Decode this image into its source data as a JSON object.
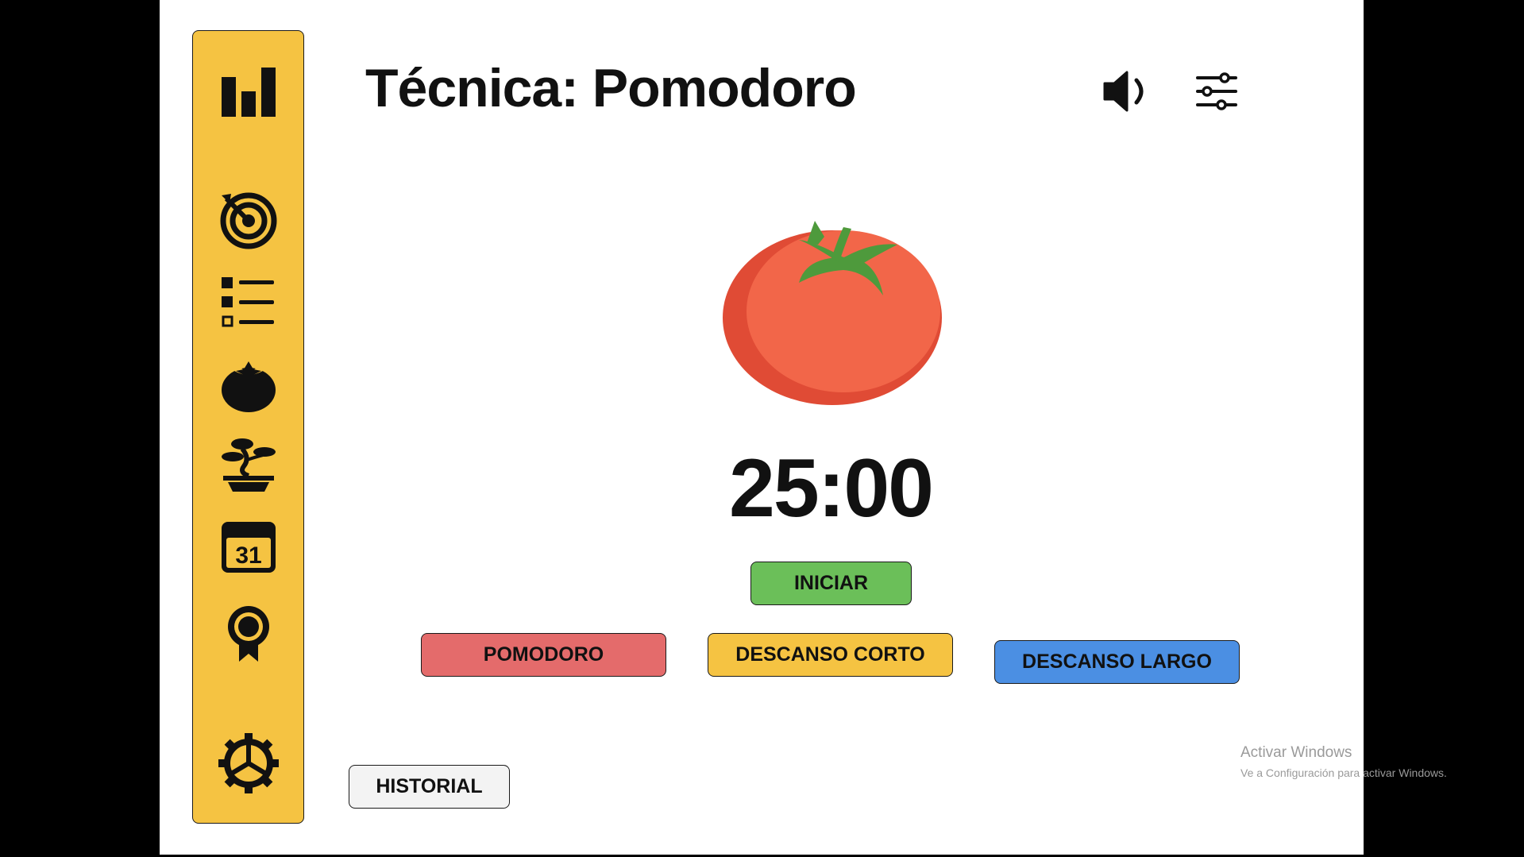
{
  "header": {
    "title": "Técnica: Pomodoro",
    "sound_icon": "speaker-volume-icon",
    "settings_icon": "sliders-icon"
  },
  "sidebar": {
    "items": [
      {
        "icon": "bar-chart-icon"
      },
      {
        "icon": "target-icon"
      },
      {
        "icon": "task-list-icon"
      },
      {
        "icon": "tomato-icon"
      },
      {
        "icon": "bonsai-icon"
      },
      {
        "icon": "calendar-icon",
        "text": "31"
      },
      {
        "icon": "award-ribbon-icon"
      },
      {
        "icon": "gear-icon"
      }
    ]
  },
  "timer": {
    "display": "25:00",
    "start_label": "INICIAR"
  },
  "modes": {
    "pomodoro": "POMODORO",
    "short_break": "DESCANSO CORTO",
    "long_break": "DESCANSO LARGO"
  },
  "history": {
    "label": "HISTORIAL"
  },
  "watermark": {
    "title": "Activar Windows",
    "subtitle": "Ve a Configuración para activar Windows."
  },
  "colors": {
    "sidebar": "#F5C342",
    "start": "#6BBF59",
    "pomodoro": "#E46B6B",
    "short_break": "#F5C342",
    "long_break": "#4B8FE3",
    "tomato": "#F26649"
  }
}
